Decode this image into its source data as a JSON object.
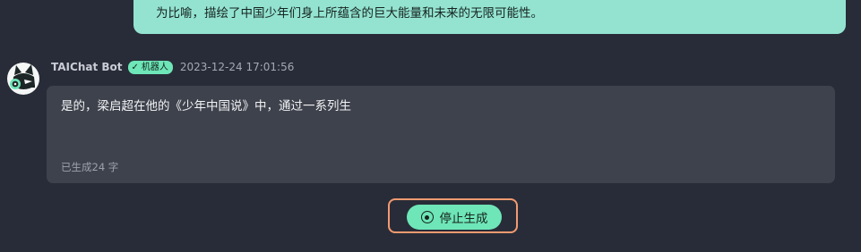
{
  "previous_message": {
    "text": "为比喻，描绘了中国少年们身上所蕴含的巨大能量和未来的无限可能性。"
  },
  "bot_message": {
    "sender": "TAIChat Bot",
    "badge": "机器人",
    "timestamp": "2023-12-24 17:01:56",
    "text": "是的，梁启超在他的《少年中国说》中，通过一系列生",
    "generated_count": "已生成24 字"
  },
  "controls": {
    "stop_label": "停止生成"
  },
  "icons": {
    "avatar": "fox-bot-avatar-icon",
    "badge": "check-icon",
    "stop": "stop-circle-icon"
  },
  "colors": {
    "background": "#282c38",
    "previous_bubble": "#94e3d1",
    "bot_bubble": "#3e424c",
    "accent": "#6ee6b8",
    "highlight_border": "#f39a70"
  }
}
